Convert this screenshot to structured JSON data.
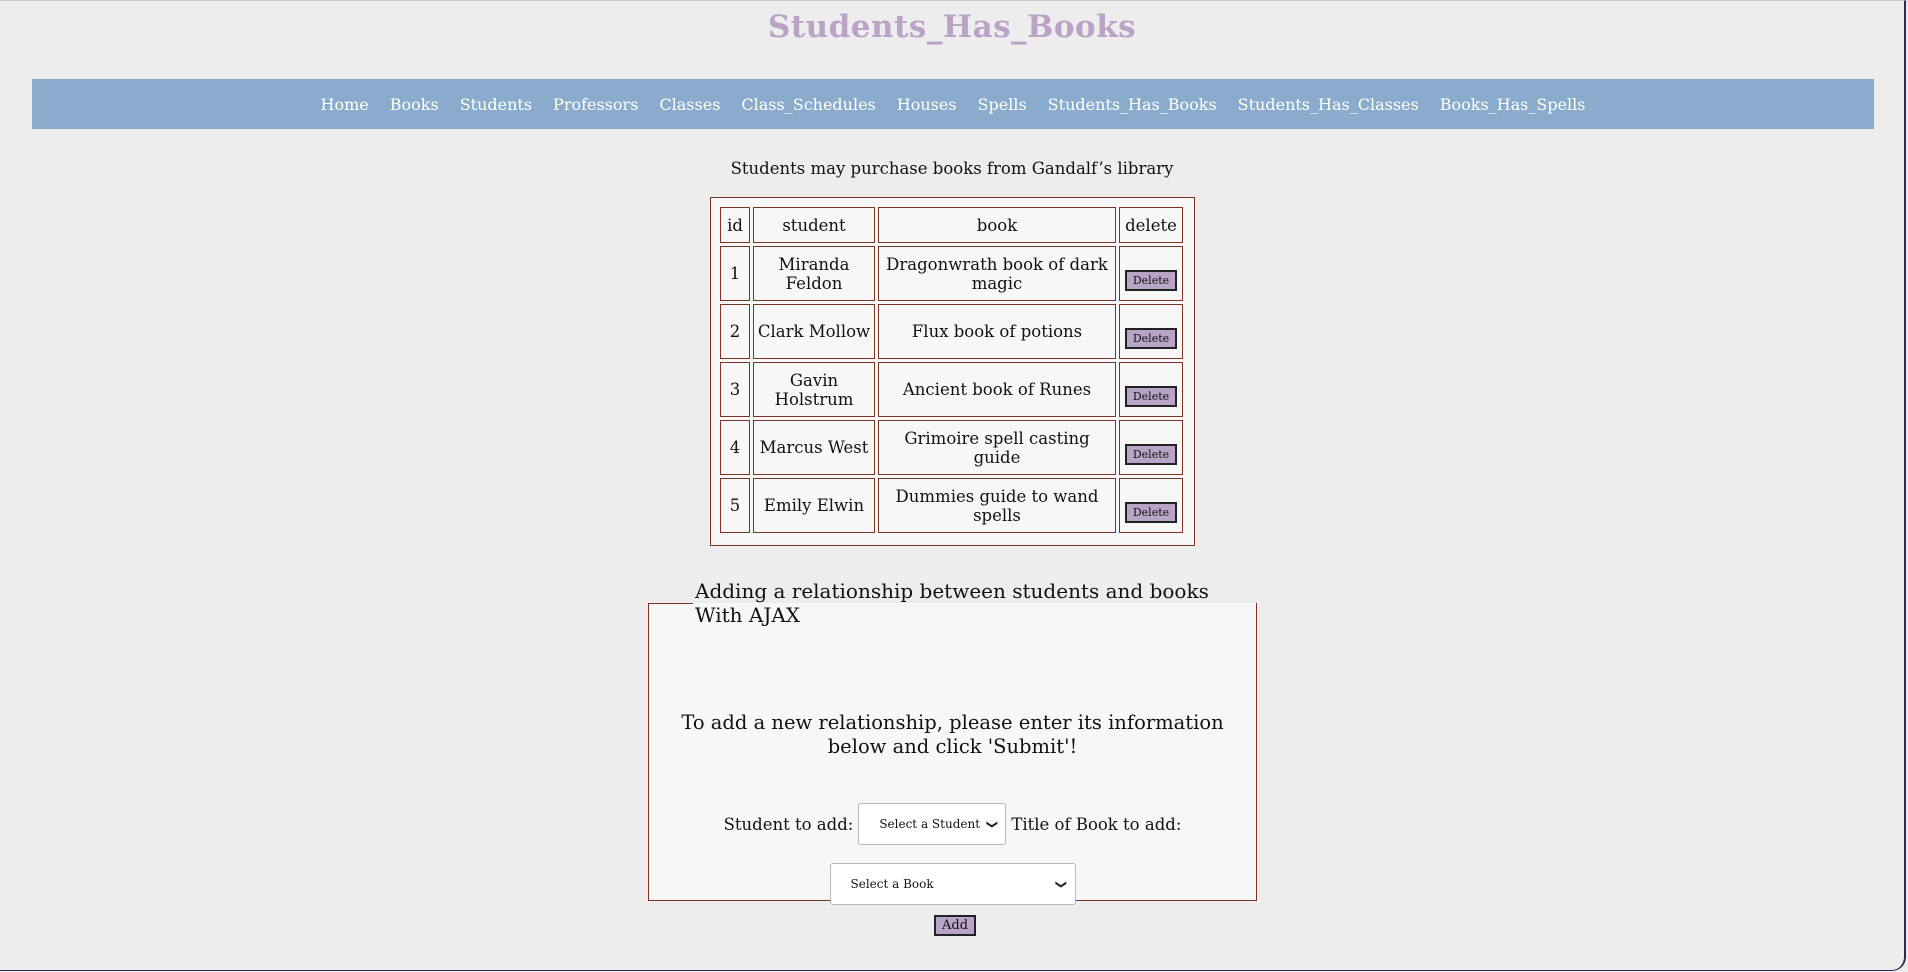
{
  "page_title": "Students_Has_Books",
  "nav": [
    {
      "label": "Home"
    },
    {
      "label": "Books"
    },
    {
      "label": "Students"
    },
    {
      "label": "Professors"
    },
    {
      "label": "Classes"
    },
    {
      "label": "Class_Schedules"
    },
    {
      "label": "Houses"
    },
    {
      "label": "Spells"
    },
    {
      "label": "Students_Has_Books"
    },
    {
      "label": "Students_Has_Classes"
    },
    {
      "label": "Books_Has_Spells"
    }
  ],
  "caption": "Students may purchase books from Gandalf’s library",
  "table": {
    "headers": [
      "id",
      "student",
      "book",
      "delete"
    ],
    "rows": [
      {
        "id": "1",
        "student": "Miranda Feldon",
        "book": "Dragonwrath book of dark magic",
        "delete_label": "Delete"
      },
      {
        "id": "2",
        "student": "Clark Mollow",
        "book": "Flux book of potions",
        "delete_label": "Delete"
      },
      {
        "id": "3",
        "student": "Gavin Holstrum",
        "book": "Ancient book of Runes",
        "delete_label": "Delete"
      },
      {
        "id": "4",
        "student": "Marcus West",
        "book": "Grimoire spell casting guide",
        "delete_label": "Delete"
      },
      {
        "id": "5",
        "student": "Emily Elwin",
        "book": "Dummies guide to wand spells",
        "delete_label": "Delete"
      }
    ]
  },
  "form": {
    "legend": "Adding a relationship between students and books With AJAX",
    "instructions": "To add a new relationship, please enter its information below and click 'Submit'!",
    "student_label": "Student to add:",
    "student_select": "Select a Student",
    "book_label": "Title of Book to add:",
    "book_select": "Select a Book"
  },
  "add_button": "Add",
  "colors": {
    "title": "#bba2c7",
    "navbar": "#8aabcb",
    "button": "#b9a3c6",
    "border": "#7a3326"
  }
}
